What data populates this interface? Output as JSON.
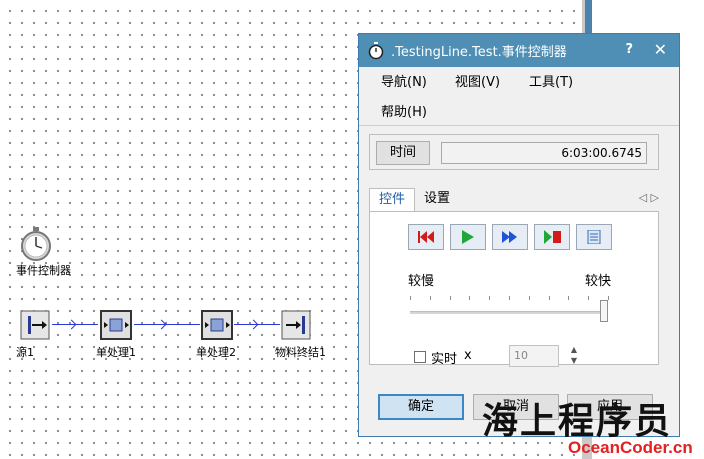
{
  "canvas": {
    "controller_label": "事件控制器",
    "objects": [
      {
        "label": "源1",
        "icon": "source-icon"
      },
      {
        "label": "单处理1",
        "icon": "single-proc-icon"
      },
      {
        "label": "单处理2",
        "icon": "single-proc-icon"
      },
      {
        "label": "物料终结1",
        "icon": "drain-icon"
      }
    ]
  },
  "dialog": {
    "title": ".TestingLine.Test.事件控制器",
    "help": "?",
    "close": "✕",
    "menu": [
      "导航(N)",
      "视图(V)",
      "工具(T)",
      "帮助(H)"
    ],
    "time_button": "时间",
    "time_value": "6:03:00.6745",
    "tabs": [
      "控件",
      "设置"
    ],
    "active_tab": "控件",
    "tab_nav": "◁ ▷",
    "speed_slow": "较慢",
    "speed_fast": "较快",
    "speed_fraction": 0.98,
    "realtime_label": "实时",
    "realtime_x": "x",
    "realtime_checked": false,
    "realtime_factor": "10",
    "buttons": {
      "ok": "确定",
      "cancel": "取消",
      "apply": "应用"
    }
  },
  "watermark": {
    "cn": "海上程序员",
    "en": "OceanCoder.cn"
  },
  "colors": {
    "titlebar": "#4f8fb5",
    "connector": "#2a3bd6",
    "accent_red": "#e42020"
  }
}
